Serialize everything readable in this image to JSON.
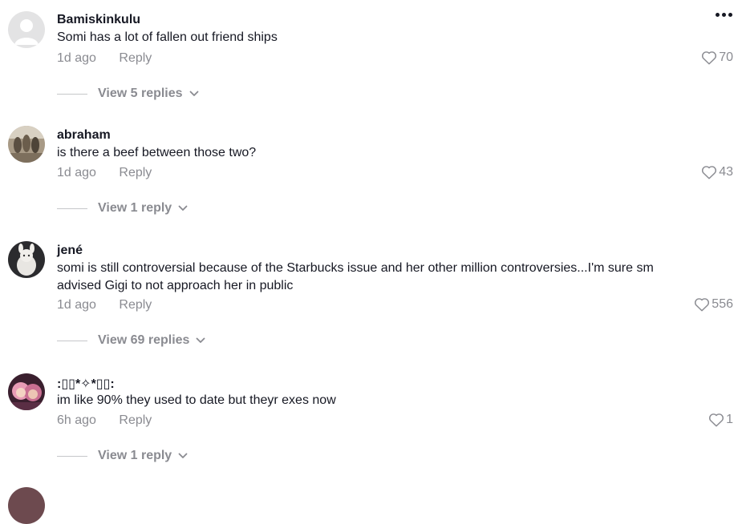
{
  "comments": [
    {
      "username": "Bamiskinkulu",
      "text": "Somi has a lot of fallen out friend ships",
      "time": "1d ago",
      "reply_label": "Reply",
      "likes": "70",
      "view_replies": "View 5 replies"
    },
    {
      "username": "abraham",
      "text": "is there a beef between those two?",
      "time": "1d ago",
      "reply_label": "Reply",
      "likes": "43",
      "view_replies": "View 1 reply"
    },
    {
      "username": "jené",
      "text": "somi is still controversial because of the Starbucks issue and her other million controversies...I'm sure sm advised Gigi to not approach her in public",
      "time": "1d ago",
      "reply_label": "Reply",
      "likes": "556",
      "view_replies": "View 69 replies"
    },
    {
      "username": ":▯▯*✧*▯▯:",
      "text": "im like 90% they used to date but theyr exes now",
      "time": "6h ago",
      "reply_label": "Reply",
      "likes": "1",
      "view_replies": "View 1 reply"
    }
  ],
  "icons": {
    "more": "more-options-icon",
    "like": "heart-outline-icon",
    "expand": "chevron-down-icon"
  }
}
